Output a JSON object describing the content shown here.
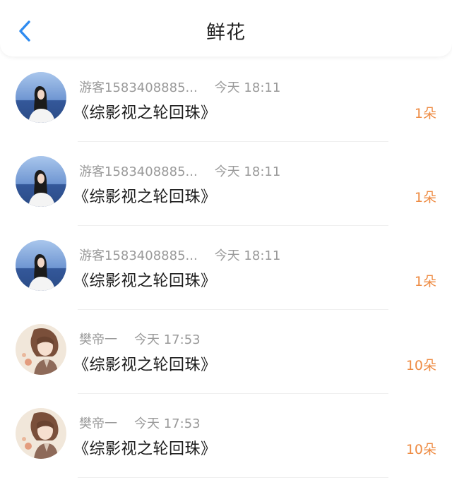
{
  "header": {
    "title": "鲜花",
    "back_icon": "chevron-left-icon",
    "accent_color": "#2f8bf0"
  },
  "items": [
    {
      "name": "游客1583408885...",
      "time": "今天 18:11",
      "book": "《综影视之轮回珠》",
      "count": "1朵",
      "avatar": "avatar-girl-sea"
    },
    {
      "name": "游客1583408885...",
      "time": "今天 18:11",
      "book": "《综影视之轮回珠》",
      "count": "1朵",
      "avatar": "avatar-girl-sea"
    },
    {
      "name": "游客1583408885...",
      "time": "今天 18:11",
      "book": "《综影视之轮回珠》",
      "count": "1朵",
      "avatar": "avatar-girl-sea"
    },
    {
      "name": "樊帝一",
      "time": "今天 17:53",
      "book": "《综影视之轮回珠》",
      "count": "10朵",
      "avatar": "avatar-anime-boy"
    },
    {
      "name": "樊帝一",
      "time": "今天 17:53",
      "book": "《综影视之轮回珠》",
      "count": "10朵",
      "avatar": "avatar-anime-boy"
    }
  ],
  "colors": {
    "meta_text": "#9a9a9a",
    "count_text": "#ee8c44",
    "title_text": "#1d1d1d"
  }
}
